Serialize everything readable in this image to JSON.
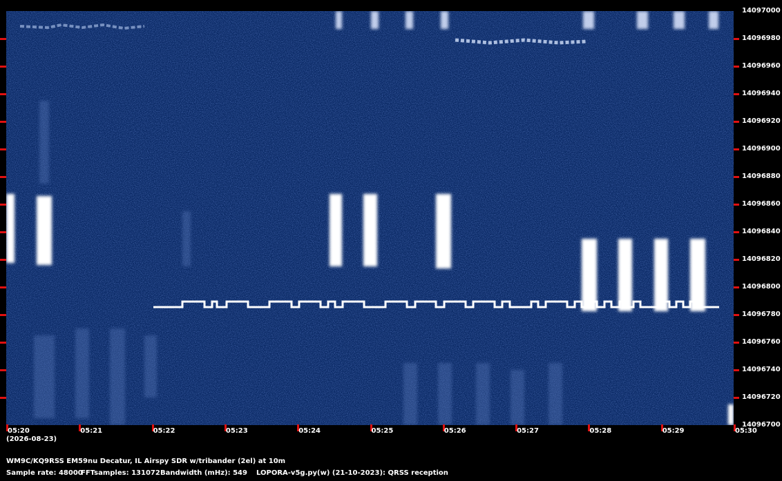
{
  "colors": {
    "background": "#000000",
    "waterfall": "#0b2a66",
    "signal": "#ffffff",
    "tick": "#e01010"
  },
  "y_axis_labels": [
    "14097000",
    "14096980",
    "14096960",
    "14096940",
    "14096920",
    "14096900",
    "14096880",
    "14096860",
    "14096840",
    "14096820",
    "14096800",
    "14096780",
    "14096760",
    "14096740",
    "14096720",
    "14096700"
  ],
  "x_axis_labels": [
    "05:20",
    "05:21",
    "05:22",
    "05:23",
    "05:24",
    "05:25",
    "05:26",
    "05:27",
    "05:28",
    "05:29",
    "05:30"
  ],
  "date_label": "(2026-08-23)",
  "info": {
    "line1": "WM9C/KQ9RSS EM59nu Decatur, IL  Airspy SDR w/tribander (2el) at 10m",
    "sample_rate": "Sample rate: 48000",
    "fft_samples": "FFTsamples: 131072",
    "bandwidth": "Bandwidth (mHz): 549",
    "software": "LOPORA-v5g.py(w) (21-10-2023): QRSS reception"
  }
}
